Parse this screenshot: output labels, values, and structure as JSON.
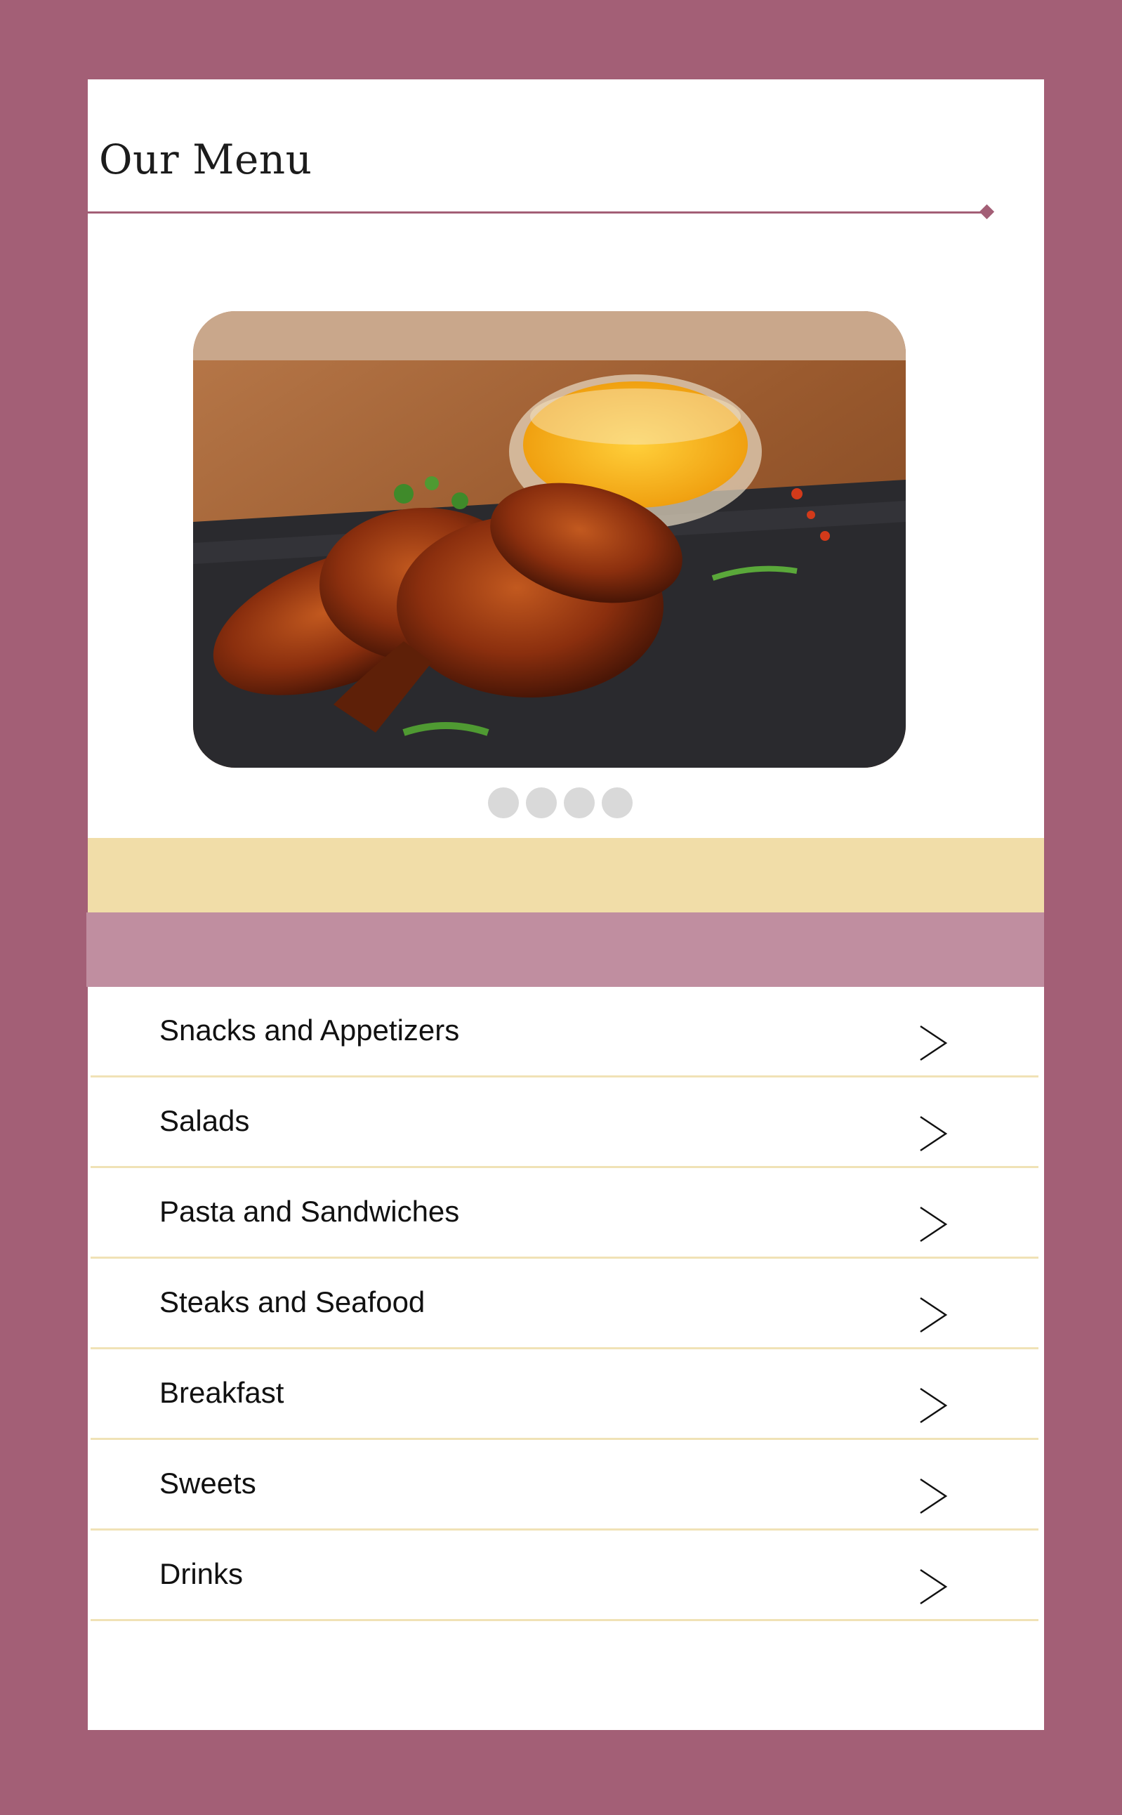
{
  "page": {
    "title": "Our Menu"
  },
  "colors": {
    "background": "#a35f76",
    "card": "#ffffff",
    "accent": "#a35f76",
    "band_yellow": "#f1dda8",
    "band_mauve": "#c08ea0",
    "divider": "#f0e2b6",
    "dot": "#d9d9d9"
  },
  "carousel": {
    "image": "grilled-chicken-wings-photo",
    "slide_count": 4
  },
  "menu": {
    "items": [
      {
        "label": "Snacks and Appetizers",
        "icon": "chevron-right-icon"
      },
      {
        "label": "Salads",
        "icon": "chevron-right-icon"
      },
      {
        "label": "Pasta and Sandwiches",
        "icon": "chevron-right-icon"
      },
      {
        "label": "Steaks and Seafood",
        "icon": "chevron-right-icon"
      },
      {
        "label": "Breakfast",
        "icon": "chevron-right-icon"
      },
      {
        "label": "Sweets",
        "icon": "chevron-right-icon"
      },
      {
        "label": "Drinks",
        "icon": "chevron-right-icon"
      }
    ]
  }
}
